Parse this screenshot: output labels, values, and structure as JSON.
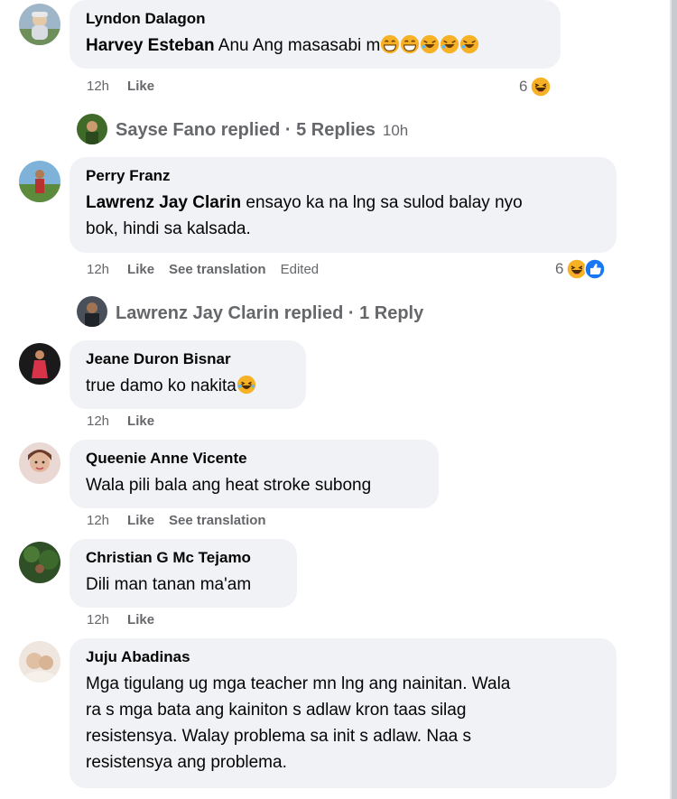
{
  "comments": [
    {
      "author": "Lyndon Dalagon",
      "mention": "Harvey Esteban",
      "text": " Anu Ang masasabi m",
      "time": "12h",
      "like": "Like",
      "reaction_count": "6"
    },
    {
      "author": "Perry Franz",
      "mention": "Lawrenz Jay Clarin",
      "text_line1": " ensayo ka na lng sa sulod balay nyo",
      "text_line2": "bok, hindi sa kalsada.",
      "time": "12h",
      "like": "Like",
      "translate": "See translation",
      "edited": "Edited",
      "reaction_count": "6"
    },
    {
      "author": "Jeane Duron Bisnar",
      "text": "true damo ko nakita",
      "time": "12h",
      "like": "Like"
    },
    {
      "author": "Queenie Anne Vicente",
      "text": "Wala pili bala ang heat stroke subong",
      "time": "12h",
      "like": "Like",
      "translate": "See translation"
    },
    {
      "author": "Christian G Mc Tejamo",
      "text": "Dili man tanan ma'am",
      "time": "12h",
      "like": "Like"
    },
    {
      "author": "Juju Abadinas",
      "lines": [
        "Mga tigulang ug mga teacher mn lng ang nainitan. Wala",
        "ra s mga bata ang kainiton s adlaw kron taas silag",
        "resistensya. Walay problema sa init s adlaw. Naa s",
        "resistensya ang problema."
      ]
    }
  ],
  "reply_threads": [
    {
      "label": "Sayse Fano replied · 5 Replies",
      "time": "10h"
    },
    {
      "label": "Lawrenz Jay Clarin replied · 1 Reply",
      "time": ""
    }
  ],
  "icons": {
    "haha": "laughing-emoji-icon",
    "grin": "grinning-emoji-icon",
    "like": "like-reaction-icon"
  },
  "colors": {
    "bubble": "#f0f2f5",
    "meta": "#65676b",
    "like_blue": "#1877f2",
    "emoji_yellow": "#f7b125"
  }
}
